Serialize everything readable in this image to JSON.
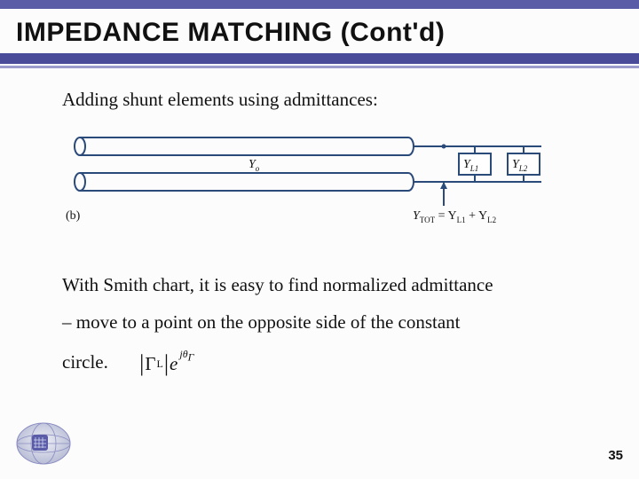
{
  "title": "IMPEDANCE MATCHING (Cont'd)",
  "para1": "Adding shunt elements using admittances:",
  "diagram": {
    "y0": "Y",
    "y0_sub": "o",
    "yl1": "Y",
    "yl1_sub": "L1",
    "yl2": "Y",
    "yl2_sub": "L2",
    "ytot_label": "Y",
    "ytot_sub": "TOT",
    "eq_text": " = Y",
    "eq_sub1": "L1",
    "eq_plus": " + Y",
    "eq_sub2": "L2",
    "panel": "(b)"
  },
  "para2_a": "With Smith chart, it is easy to find normalized admittance",
  "para2_b": "– move to a point on the opposite side of the constant",
  "para2_c": "circle.",
  "formula": {
    "gamma": "Γ",
    "gamma_sub": "L",
    "e": "e",
    "exp_j": "j",
    "exp_theta": "θ",
    "exp_sub": "Γ"
  },
  "page": "35"
}
